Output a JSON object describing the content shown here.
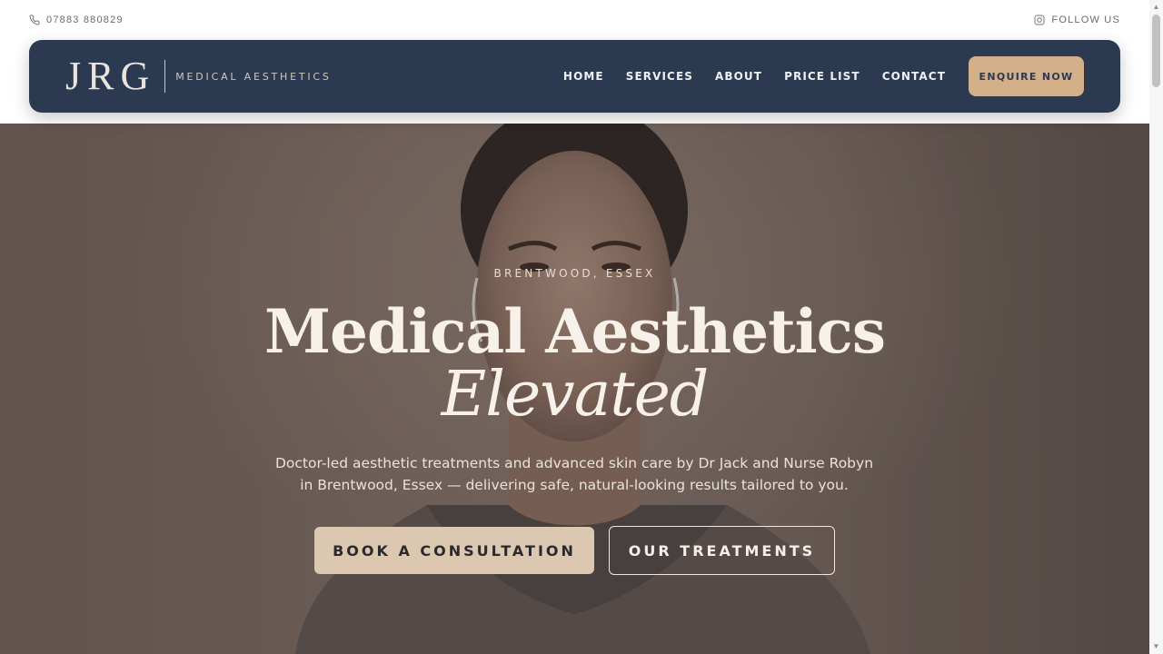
{
  "topbar": {
    "phone": "07883 880829",
    "follow": "FOLLOW US",
    "phone_icon": "phone-icon",
    "instagram_icon": "instagram-icon"
  },
  "logo": {
    "mark": "JRG",
    "sub": "MEDICAL AESTHETICS"
  },
  "nav": {
    "items": [
      "HOME",
      "SERVICES",
      "ABOUT",
      "PRICE LIST",
      "CONTACT"
    ],
    "enquire": "ENQUIRE NOW"
  },
  "hero": {
    "eyebrow": "BRENTWOOD, ESSEX",
    "title_line1": "Medical Aesthetics",
    "title_line2": "Elevated",
    "lead": "Doctor-led aesthetic treatments and advanced skin care by Dr Jack and Nurse Robyn in Brentwood, Essex — delivering safe, natural-looking results tailored to you.",
    "cta_primary": "BOOK A CONSULTATION",
    "cta_secondary": "OUR TREATMENTS"
  },
  "colors": {
    "nav_bg": "#2b3a50",
    "accent": "#d4b08a",
    "cta_primary": "#dcc7b0"
  }
}
